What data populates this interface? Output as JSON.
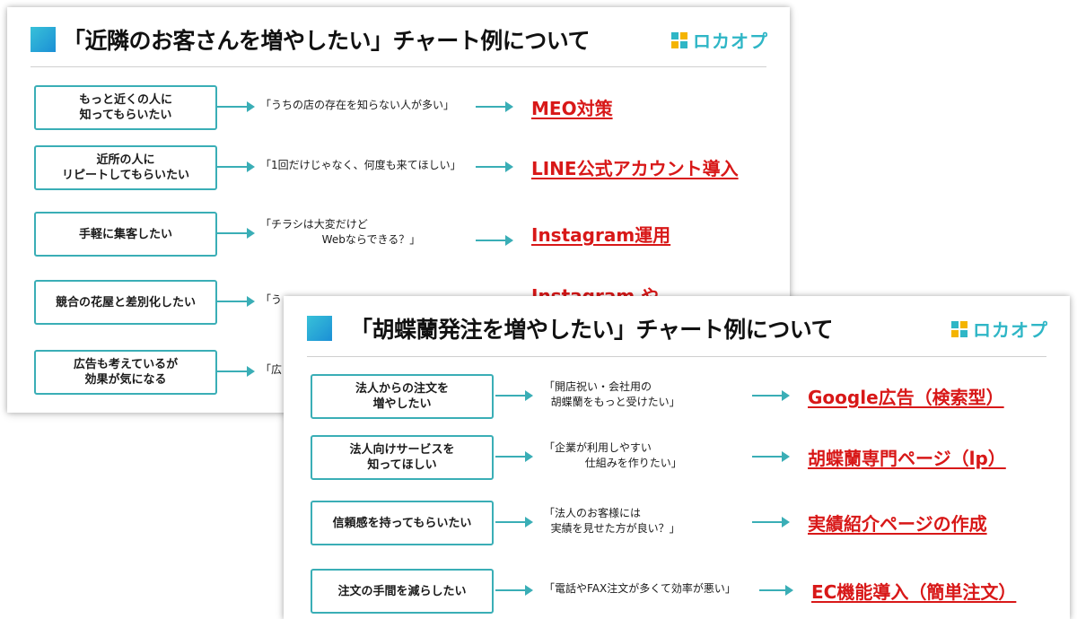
{
  "slide1": {
    "title": "「近隣のお客さんを増やしたい」チャート例について",
    "logo_text": "ロカオプ",
    "rows": [
      {
        "need": "もっと近くの人に\n知ってもらいたい",
        "voice": "「うちの店の存在を知らない人が多い」",
        "solution": "MEO対策"
      },
      {
        "need": "近所の人に\nリピートしてもらいたい",
        "voice": "「1回だけじゃなく、何度も来てほしい」",
        "solution": "LINE公式アカウント導入"
      },
      {
        "need": "手軽に集客したい",
        "voice": "「チラシは大変だけど\n                  Webならできる？」",
        "solution": "Instagram運用"
      },
      {
        "need": "競合の花屋と差別化したい",
        "voice": "「う",
        "solution": "Instagram や"
      },
      {
        "need": "広告も考えているが\n効果が気になる",
        "voice": "「広",
        "solution": ""
      }
    ]
  },
  "slide2": {
    "title": "「胡蝶蘭発注を増やしたい」チャート例について",
    "logo_text": "ロカオプ",
    "rows": [
      {
        "need": "法人からの注文を\n増やしたい",
        "voice": "「開店祝い・会社用の\n  胡蝶蘭をもっと受けたい」",
        "solution": "Google広告（検索型）"
      },
      {
        "need": "法人向けサービスを\n知ってほしい",
        "voice": "「企業が利用しやすい\n            仕組みを作りたい」",
        "solution": "胡蝶蘭専門ページ（lp）"
      },
      {
        "need": "信頼感を持ってもらいたい",
        "voice": "「法人のお客様には\n  実績を見せた方が良い？」",
        "solution": "実績紹介ページの作成"
      },
      {
        "need": "注文の手間を減らしたい",
        "voice": "「電話やFAX注文が多くて効率が悪い」",
        "solution": "EC機能導入（簡単注文）"
      }
    ]
  }
}
